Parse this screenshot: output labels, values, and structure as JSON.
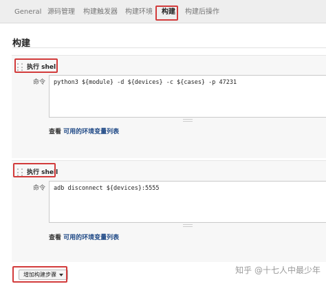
{
  "tabs": [
    {
      "label": "General"
    },
    {
      "label": "源码管理"
    },
    {
      "label": "构建触发器"
    },
    {
      "label": "构建环境"
    },
    {
      "label": "构建"
    },
    {
      "label": "构建后操作"
    }
  ],
  "active_tab": "构建",
  "section_title": "构建",
  "steps": [
    {
      "title": "执行 shell",
      "field_label": "命令",
      "command": "python3 ${module} -d ${devices} -c ${cases} -p 47231",
      "env_prefix": "查看",
      "env_link": "可用的环境变量列表"
    },
    {
      "title": "执行 shell",
      "field_label": "命令",
      "command": "adb disconnect ${devices}:5555",
      "env_prefix": "查看",
      "env_link": "可用的环境变量列表"
    }
  ],
  "add_step_button": "增加构建步骤",
  "watermark": {
    "text": "知乎 @十七人中最少年",
    "icon": "zhihu-logo-icon"
  },
  "colors": {
    "highlight_border": "#d23a3a",
    "link": "#204a87",
    "tab_bar": "#eeeeee",
    "step_bg": "#f7f7f7"
  }
}
